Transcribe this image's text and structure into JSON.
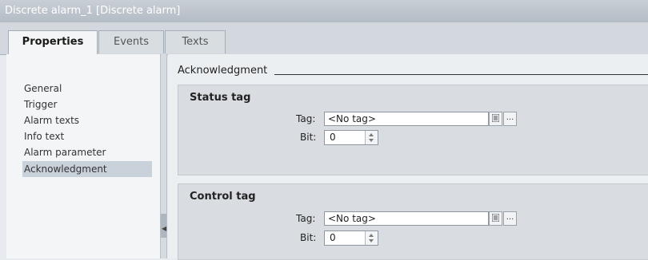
{
  "window": {
    "title": "Discrete alarm_1 [Discrete alarm]"
  },
  "tabs": [
    {
      "label": "Properties",
      "active": true
    },
    {
      "label": "Events",
      "active": false
    },
    {
      "label": "Texts",
      "active": false
    }
  ],
  "nav": [
    {
      "label": "General"
    },
    {
      "label": "Trigger"
    },
    {
      "label": "Alarm texts"
    },
    {
      "label": "Info text"
    },
    {
      "label": "Alarm parameter"
    },
    {
      "label": "Acknowledgment",
      "active": true
    }
  ],
  "section": {
    "title": "Acknowledgment"
  },
  "status_tag": {
    "title": "Status tag",
    "tag_label": "Tag:",
    "tag_value": "<No tag>",
    "bit_label": "Bit:",
    "bit_value": "0"
  },
  "control_tag": {
    "title": "Control tag",
    "tag_label": "Tag:",
    "tag_value": "<No tag>",
    "bit_label": "Bit:",
    "bit_value": "0"
  },
  "colors": {
    "active_nav_bg": "#c9d1db",
    "title_bar": "#b9c0c8"
  },
  "icons": {
    "list_button": "list-icon",
    "more_button": "ellipsis-icon"
  }
}
